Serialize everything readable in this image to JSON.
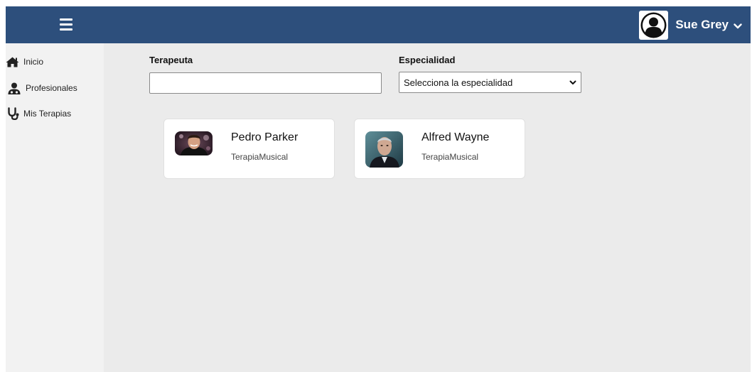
{
  "header": {
    "user_name": "Sue Grey",
    "menu_icon": "hamburger-icon",
    "avatar_icon": "user-silhouette-icon",
    "caret_icon": "chevron-down-icon",
    "bg_color": "#2d4f7c"
  },
  "sidebar": {
    "items": [
      {
        "label": "Inicio",
        "icon": "home-icon"
      },
      {
        "label": "Profesionales",
        "icon": "user-doctor-icon"
      },
      {
        "label": "Mis Terapias",
        "icon": "stethoscope-icon"
      }
    ]
  },
  "filters": {
    "terapeuta_label": "Terapeuta",
    "terapeuta_value": "",
    "especialidad_label": "Especialidad",
    "especialidad_selected": "Selecciona la especialidad"
  },
  "cards": [
    {
      "name": "Pedro Parker",
      "specialty": "TerapiaMusical"
    },
    {
      "name": "Alfred Wayne",
      "specialty": "TerapiaMusical"
    }
  ]
}
